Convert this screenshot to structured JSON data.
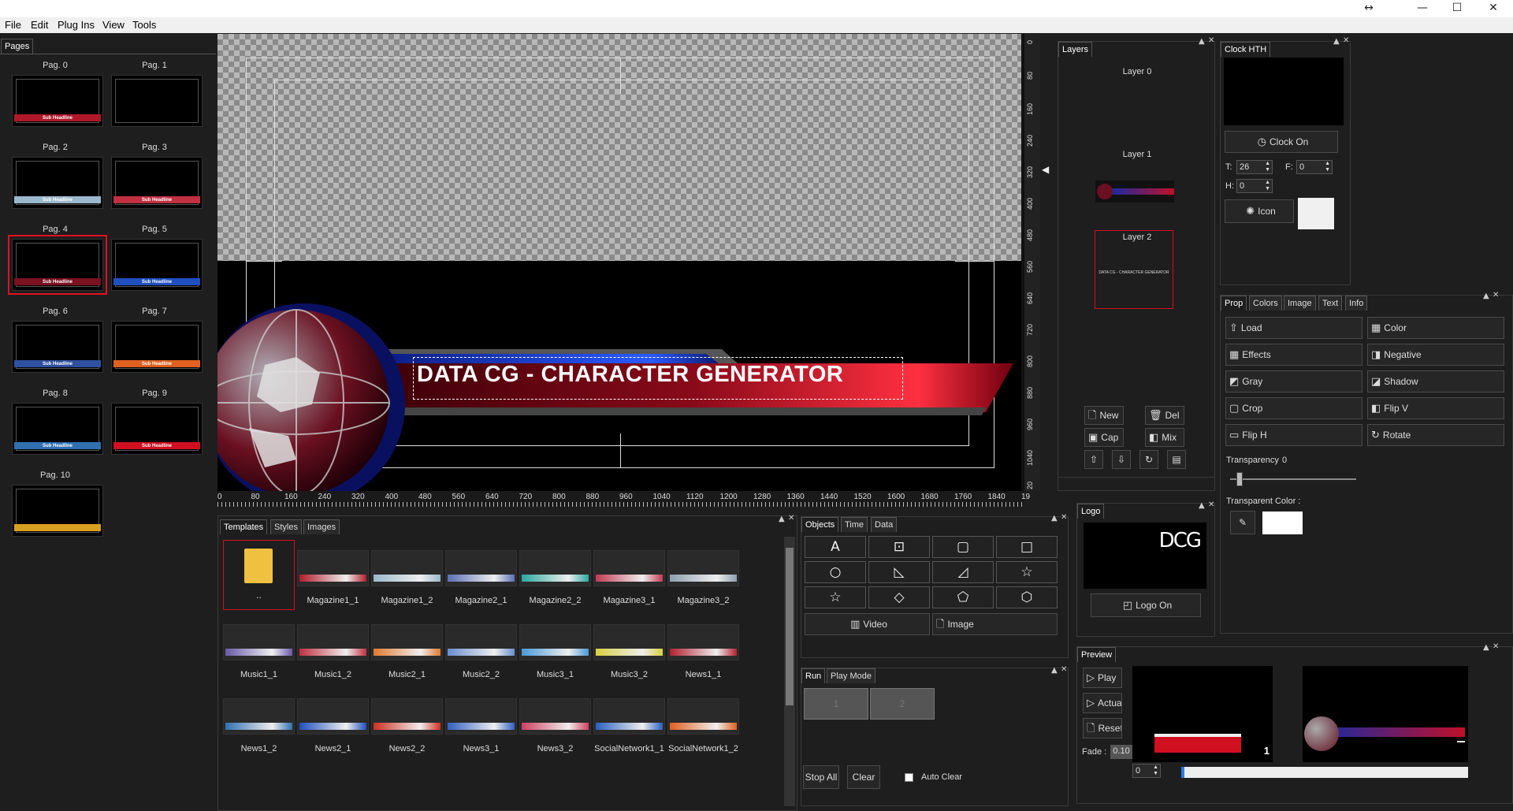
{
  "window": {
    "restore_icon": "resize-icon",
    "min": "—",
    "max": "☐",
    "close": "✕"
  },
  "menu": [
    "File",
    "Edit",
    "Plug Ins",
    "View",
    "Tools"
  ],
  "pages_panel": {
    "tab": "Pages",
    "pages": [
      {
        "label": "Pag. 0",
        "text": "Sub Headline"
      },
      {
        "label": "Pag. 1",
        "text": ""
      },
      {
        "label": "Pag. 2",
        "text": "Sub Headline"
      },
      {
        "label": "Pag. 3",
        "text": "Sub Headline"
      },
      {
        "label": "Pag. 4",
        "text": "Sub Headline"
      },
      {
        "label": "Pag. 5",
        "text": "Sub Headline"
      },
      {
        "label": "Pag. 6",
        "text": "Sub Headline"
      },
      {
        "label": "Pag. 7",
        "text": "Sub Headline"
      },
      {
        "label": "Pag. 8",
        "text": "Sub Headline"
      },
      {
        "label": "Pag. 9",
        "text": "Sub Headline"
      },
      {
        "label": "Pag. 10",
        "text": ""
      }
    ],
    "selected_index": 4
  },
  "canvas": {
    "headline": "DATA CG - CHARACTER GENERATOR",
    "h_ruler": [
      "0",
      "80",
      "160",
      "240",
      "320",
      "400",
      "480",
      "560",
      "640",
      "720",
      "800",
      "880",
      "960",
      "1040",
      "1120",
      "1200",
      "1280",
      "1360",
      "1440",
      "1520",
      "1600",
      "1680",
      "1760",
      "1840",
      "19"
    ],
    "v_ruler": [
      "0",
      "80",
      "160",
      "240",
      "320",
      "400",
      "480",
      "560",
      "640",
      "720",
      "800",
      "880",
      "960",
      "1040",
      "20"
    ]
  },
  "layers_panel": {
    "title": "Layers",
    "layers": [
      "Layer 0",
      "Layer 1",
      "Layer 2"
    ],
    "layer2_text": "DATA CG - CHARACTER GENERATOR",
    "buttons": {
      "new": "New",
      "del": "Del",
      "cap": "Cap",
      "mix": "Mix"
    }
  },
  "clock_panel": {
    "title": "Clock HTH",
    "clock_on": "Clock On",
    "t_label": "T:",
    "t_value": "26",
    "f_label": "F:",
    "f_value": "0",
    "h_label": "H:",
    "h_value": "0",
    "icon": "Icon"
  },
  "prop_panel": {
    "tabs": [
      "Prop",
      "Colors",
      "Image",
      "Text",
      "Info"
    ],
    "buttons": [
      "Load",
      "Color",
      "Effects",
      "Negative",
      "Gray",
      "Shadow",
      "Crop",
      "Flip V",
      "Flip H",
      "Rotate"
    ],
    "transparency_label": "Transparency",
    "transparency_value": "0",
    "transparency_level": 0.1,
    "transparent_color_label": "Transparent Color :",
    "transparent_color": "#ffffff"
  },
  "library": {
    "tabs": [
      "Templates",
      "Styles",
      "Images"
    ],
    "folder_label": "..",
    "items": [
      {
        "label": "Magazine1_1",
        "color": "#b11d2a"
      },
      {
        "label": "Magazine1_2",
        "color": "#9bb8cc"
      },
      {
        "label": "Magazine2_1",
        "color": "#5a6fb3"
      },
      {
        "label": "Magazine2_2",
        "color": "#2aa9a0"
      },
      {
        "label": "Magazine3_1",
        "color": "#c03a52"
      },
      {
        "label": "Magazine3_2",
        "color": "#8ea0b0"
      },
      {
        "label": "Music1_1",
        "color": "#6a5aa8"
      },
      {
        "label": "Music1_2",
        "color": "#c03040"
      },
      {
        "label": "Music2_1",
        "color": "#e07a30"
      },
      {
        "label": "Music2_2",
        "color": "#6a8ed0"
      },
      {
        "label": "Music3_1",
        "color": "#4a9ad8"
      },
      {
        "label": "Music3_2",
        "color": "#d8d040"
      },
      {
        "label": "News1_1",
        "color": "#b02030"
      },
      {
        "label": "News1_2",
        "color": "#3070b0"
      },
      {
        "label": "News2_1",
        "color": "#2050c0"
      },
      {
        "label": "News2_2",
        "color": "#d03020"
      },
      {
        "label": "News3_1",
        "color": "#3060c0"
      },
      {
        "label": "News3_2",
        "color": "#d04060"
      },
      {
        "label": "SocialNetwork1_1",
        "color": "#2a60c0"
      },
      {
        "label": "SocialNetwork1_2",
        "color": "#e06020"
      }
    ]
  },
  "objects_panel": {
    "tabs": [
      "Objects",
      "Time",
      "Data"
    ],
    "shapes": [
      "A",
      "[A]",
      "rounded-rect",
      "square",
      "circle",
      "right-triangle",
      "corner-shape",
      "star",
      "star-outline",
      "diamond",
      "pentagon",
      "hexagon"
    ],
    "video": "Video",
    "image": "Image"
  },
  "run_panel": {
    "tabs": [
      "Run",
      "Play Mode"
    ],
    "slots": [
      "1",
      "2"
    ],
    "stop_all": "Stop All",
    "clear": "Clear",
    "auto_clear": "Auto Clear"
  },
  "logo_panel": {
    "title": "Logo",
    "logo_text": "DCG",
    "logo_on": "Logo On"
  },
  "preview_panel": {
    "title": "Preview",
    "play": "Play",
    "actual": "Actual",
    "reset": "Reset",
    "fade_label": "Fade :",
    "fade_value": "0.10",
    "counter": "0",
    "left_number": "1",
    "progress": 0.01
  }
}
